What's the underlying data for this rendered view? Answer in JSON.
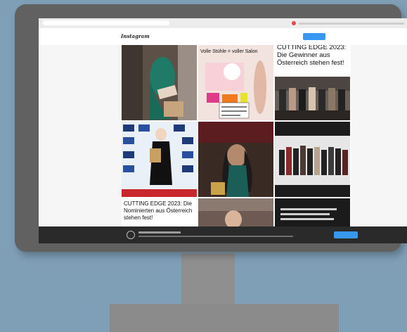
{
  "scene": {
    "colors": {
      "background": "#7f9fb6",
      "monitor_bezel": "#616161",
      "stand": "#8f8f8f",
      "instagram_blue": "#3897f0"
    }
  },
  "browser": {
    "header": {
      "logo": "Instagram"
    },
    "grid": {
      "posts": [
        {
          "caption": ""
        },
        {
          "caption": "Volle Stühle = voller Salon"
        },
        {
          "caption": "CUTTING EDGE 2023: Die Gewinner aus Österreich stehen fest!"
        },
        {
          "caption": ""
        },
        {
          "caption": ""
        },
        {
          "caption": ""
        },
        {
          "caption": "CUTTING EDGE 2023: Die Nominierten aus Österreich stehen fest!"
        },
        {
          "caption": ""
        },
        {
          "caption": ""
        }
      ]
    }
  }
}
